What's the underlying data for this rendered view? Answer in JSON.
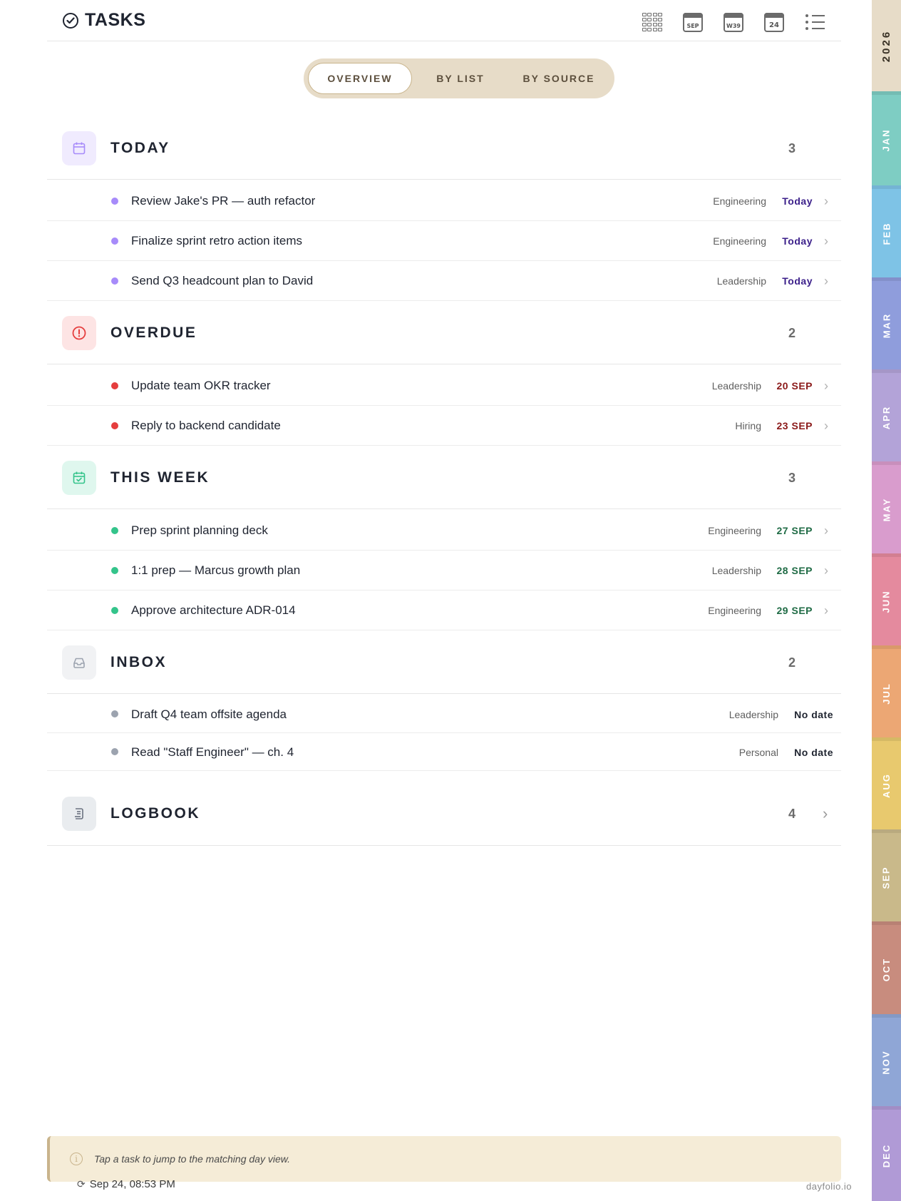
{
  "header": {
    "title": "TASKS",
    "toolbar": {
      "month_label": "SEP",
      "week_label": "W39",
      "day_label": "24"
    }
  },
  "segment": {
    "overview": "OVERVIEW",
    "by_list": "BY LIST",
    "by_source": "BY SOURCE"
  },
  "sections": {
    "today": {
      "title": "TODAY",
      "count": "3",
      "color": "#a78bfa",
      "tasks": [
        {
          "text": "Review Jake's PR — auth refactor",
          "tag": "Engineering",
          "date": "Today"
        },
        {
          "text": "Finalize sprint retro action items",
          "tag": "Engineering",
          "date": "Today"
        },
        {
          "text": "Send Q3 headcount plan to David",
          "tag": "Leadership",
          "date": "Today"
        }
      ]
    },
    "overdue": {
      "title": "OVERDUE",
      "count": "2",
      "color": "#e53e3e",
      "tasks": [
        {
          "text": "Update team OKR tracker",
          "tag": "Leadership",
          "date": "20 SEP"
        },
        {
          "text": "Reply to backend candidate",
          "tag": "Hiring",
          "date": "23 SEP"
        }
      ]
    },
    "this_week": {
      "title": "THIS WEEK",
      "count": "3",
      "color": "#34c48b",
      "tasks": [
        {
          "text": "Prep sprint planning deck",
          "tag": "Engineering",
          "date": "27 SEP"
        },
        {
          "text": "1:1 prep — Marcus growth plan",
          "tag": "Leadership",
          "date": "28 SEP"
        },
        {
          "text": "Approve architecture ADR-014",
          "tag": "Engineering",
          "date": "29 SEP"
        }
      ]
    },
    "inbox": {
      "title": "INBOX",
      "count": "2",
      "color": "#9ca3af",
      "tasks": [
        {
          "text": "Draft Q4 team offsite agenda",
          "tag": "Leadership",
          "date": "No date"
        },
        {
          "text": "Read \"Staff Engineer\" — ch. 4",
          "tag": "Personal",
          "date": "No date"
        }
      ]
    },
    "logbook": {
      "title": "LOGBOOK",
      "count": "4"
    }
  },
  "footer": {
    "hint": "Tap a task to jump to the matching day view.",
    "synced": "Sep 24, 08:53 PM",
    "domain": "dayfolio.io"
  },
  "tabs": {
    "year": "2026",
    "months": [
      {
        "label": "JAN",
        "color": "#7ecdc3"
      },
      {
        "label": "FEB",
        "color": "#7ec3e6"
      },
      {
        "label": "MAR",
        "color": "#8f9ddc"
      },
      {
        "label": "APR",
        "color": "#b3a3d8"
      },
      {
        "label": "MAY",
        "color": "#d99ccd"
      },
      {
        "label": "JUN",
        "color": "#e48a9e"
      },
      {
        "label": "JUL",
        "color": "#eca774"
      },
      {
        "label": "AUG",
        "color": "#e8c96e"
      },
      {
        "label": "SEP",
        "color": "#c9b98a"
      },
      {
        "label": "OCT",
        "color": "#c88c7e"
      },
      {
        "label": "NOV",
        "color": "#8fa6d6"
      },
      {
        "label": "DEC",
        "color": "#b09ad6"
      }
    ]
  }
}
